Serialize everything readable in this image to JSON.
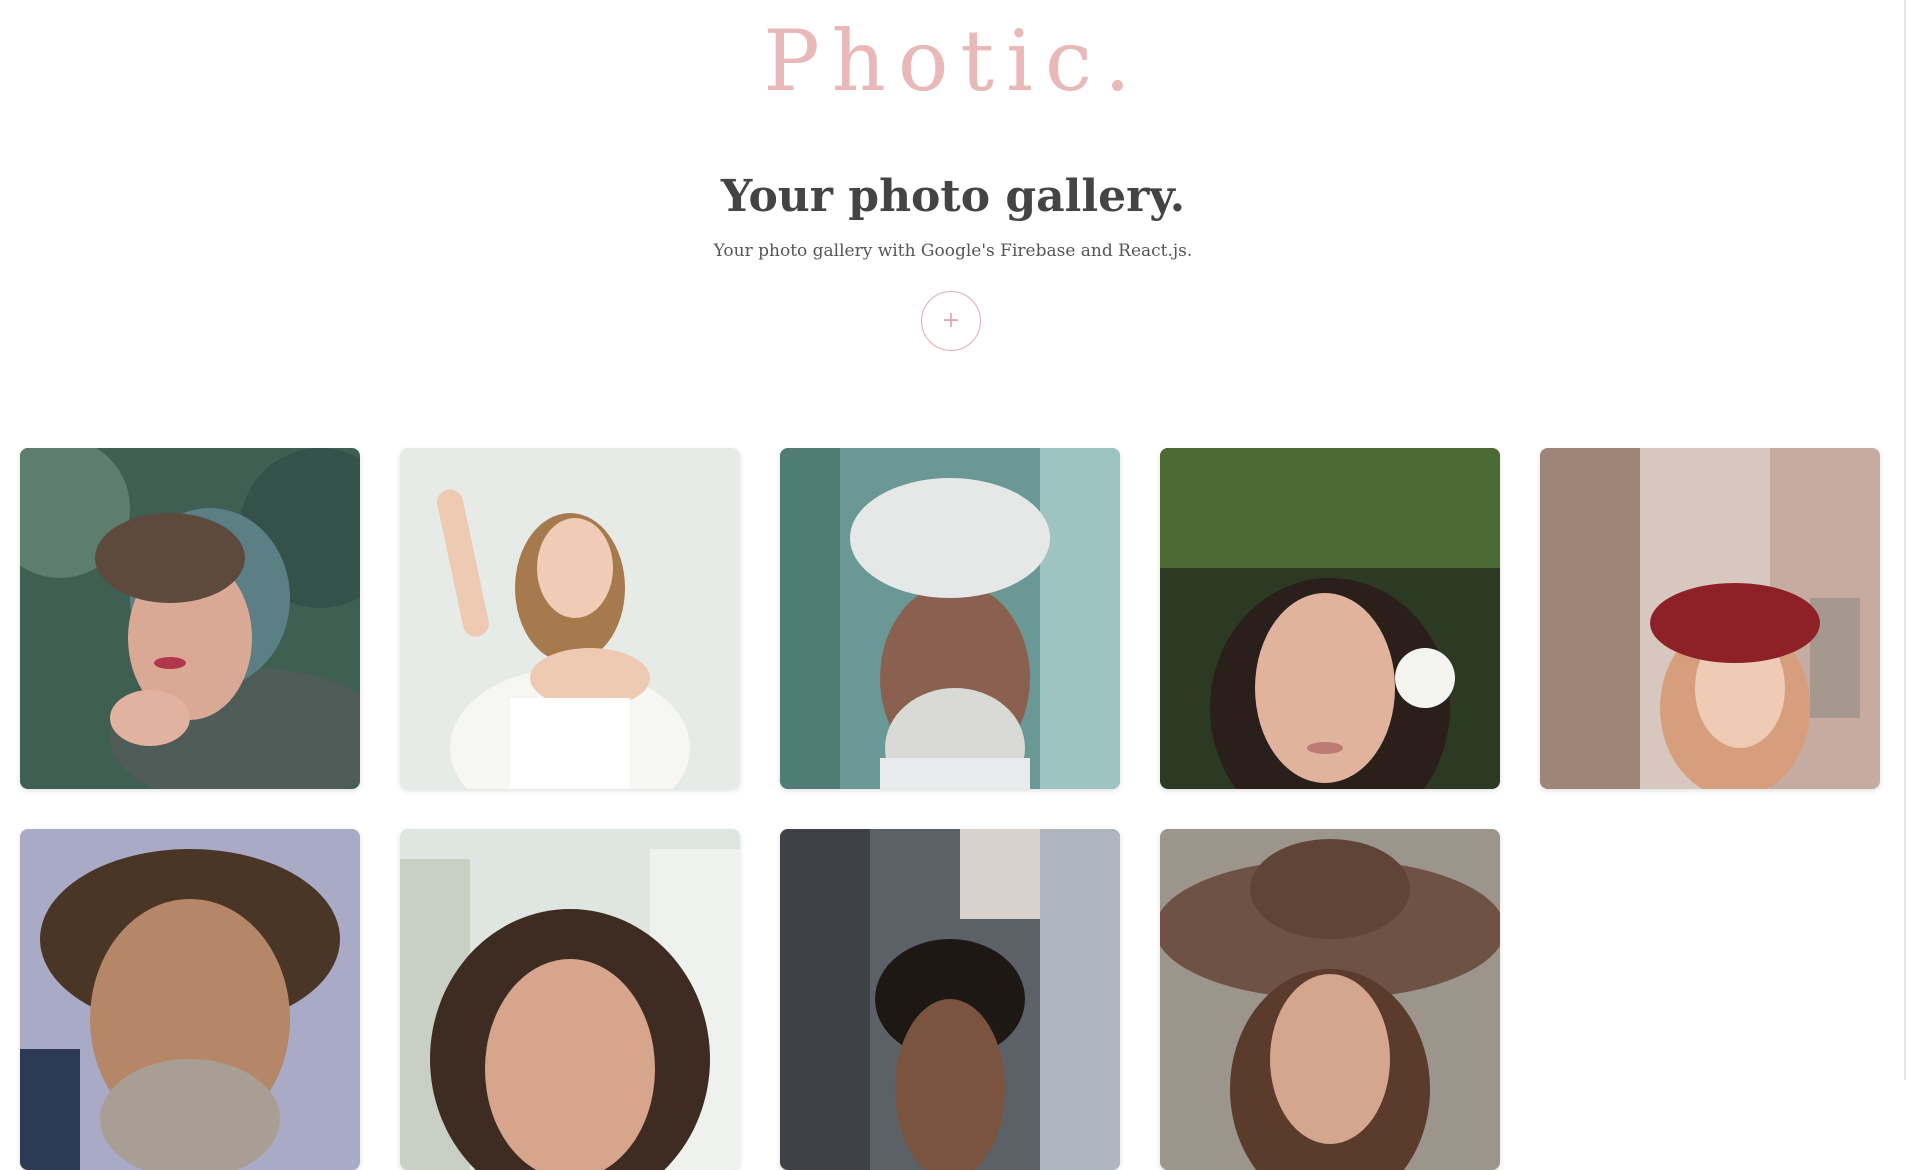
{
  "header": {
    "logo": "Photic."
  },
  "hero": {
    "title": "Your photo gallery.",
    "subtitle": "Your photo gallery with Google's Firebase and React.js.",
    "upload_button": {
      "icon": "plus-icon",
      "glyph": "+"
    }
  },
  "colors": {
    "accent": "#e9b8b8",
    "title": "#444444",
    "text": "#555555"
  },
  "gallery": {
    "photos": [
      {
        "name": "photo-woman-knit-beanie"
      },
      {
        "name": "photo-woman-arm-raised"
      },
      {
        "name": "photo-old-man-white-turban"
      },
      {
        "name": "photo-woman-white-flower"
      },
      {
        "name": "photo-woman-red-beret"
      },
      {
        "name": "photo-old-man-curly-hair"
      },
      {
        "name": "photo-girl-freckles"
      },
      {
        "name": "photo-young-man-curly-hair"
      },
      {
        "name": "photo-woman-brown-hat"
      }
    ]
  }
}
